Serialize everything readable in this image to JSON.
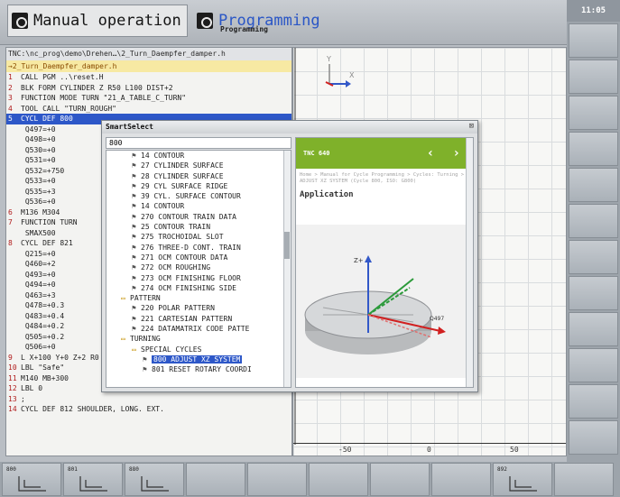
{
  "header": {
    "manual_label": "Manual operation",
    "programming_label": "Programming",
    "programming_sub": "Programming",
    "clock": "11:05"
  },
  "program": {
    "path": "TNC:\\nc_prog\\demo\\Drehen…\\2_Turn_Daempfer_damper.h",
    "file": "→2_Turn_Daempfer_damper.h",
    "lines": [
      {
        "n": "1",
        "text": "CALL PGM ..\\reset.H"
      },
      {
        "n": "2",
        "text": "BLK FORM CYLINDER Z R50 L100 DIST+2"
      },
      {
        "n": "3",
        "text": "FUNCTION MODE TURN \"21_A_TABLE_C_TURN\""
      },
      {
        "n": "4",
        "text": "TOOL CALL \"TURN_ROUGH\""
      },
      {
        "n": "5",
        "text": "CYCL DEF 800"
      },
      {
        "n": "",
        "text": "  Q497=+0"
      },
      {
        "n": "",
        "text": "  Q498=+0"
      },
      {
        "n": "",
        "text": "  Q530=+0"
      },
      {
        "n": "",
        "text": "  Q531=+0"
      },
      {
        "n": "",
        "text": "  Q532=+750"
      },
      {
        "n": "",
        "text": "  Q533=+0"
      },
      {
        "n": "",
        "text": "  Q535=+3"
      },
      {
        "n": "",
        "text": "  Q536=+0"
      },
      {
        "n": "6",
        "text": "M136 M304"
      },
      {
        "n": "7",
        "text": "FUNCTION TURN"
      },
      {
        "n": "",
        "text": "  SMAX500"
      },
      {
        "n": "8",
        "text": "CYCL DEF 821"
      },
      {
        "n": "",
        "text": "  Q215=+0"
      },
      {
        "n": "",
        "text": "  Q460=+2"
      },
      {
        "n": "",
        "text": "  Q493=+0"
      },
      {
        "n": "",
        "text": "  Q494=+0"
      },
      {
        "n": "",
        "text": "  Q463=+3"
      },
      {
        "n": "",
        "text": "  Q478=+0.3"
      },
      {
        "n": "",
        "text": "  Q483=+0.4"
      },
      {
        "n": "",
        "text": "  Q484=+0.2"
      },
      {
        "n": "",
        "text": "  Q505=+0.2"
      },
      {
        "n": "",
        "text": "  Q506=+0"
      },
      {
        "n": "9",
        "text": "L  X+100  Y+0  Z+2 R0 FMAX M99"
      },
      {
        "n": "10",
        "text": "LBL \"Safe\""
      },
      {
        "n": "11",
        "text": "M140 MB+300"
      },
      {
        "n": "12",
        "text": "LBL 0"
      },
      {
        "n": "13",
        "text": ";"
      },
      {
        "n": "14",
        "text": "CYCL DEF 812 SHOULDER, LONG. EXT."
      }
    ]
  },
  "graphic": {
    "ruler_left": "-50",
    "ruler_mid": "0",
    "ruler_right": "50"
  },
  "smartselect": {
    "title": "SmartSelect",
    "search_value": "800",
    "tree": [
      {
        "icon": "cycle",
        "indent": 2,
        "text": "14 CONTOUR"
      },
      {
        "icon": "cycle",
        "indent": 2,
        "text": "27 CYLINDER SURFACE"
      },
      {
        "icon": "cycle",
        "indent": 2,
        "text": "28 CYLINDER SURFACE"
      },
      {
        "icon": "cycle",
        "indent": 2,
        "text": "29 CYL SURFACE RIDGE"
      },
      {
        "icon": "cycle",
        "indent": 2,
        "text": "39 CYL. SURFACE CONTOUR"
      },
      {
        "icon": "cycle",
        "indent": 2,
        "text": "14 CONTOUR"
      },
      {
        "icon": "cycle",
        "indent": 2,
        "text": "270 CONTOUR TRAIN DATA"
      },
      {
        "icon": "cycle",
        "indent": 2,
        "text": "25 CONTOUR TRAIN"
      },
      {
        "icon": "cycle",
        "indent": 2,
        "text": "275 TROCHOIDAL SLOT"
      },
      {
        "icon": "cycle",
        "indent": 2,
        "text": "276 THREE-D CONT. TRAIN"
      },
      {
        "icon": "cycle",
        "indent": 2,
        "text": "271 OCM CONTOUR DATA"
      },
      {
        "icon": "cycle",
        "indent": 2,
        "text": "272 OCM ROUGHING"
      },
      {
        "icon": "cycle",
        "indent": 2,
        "text": "273 OCM FINISHING FLOOR"
      },
      {
        "icon": "cycle",
        "indent": 2,
        "text": "274 OCM FINISHING SIDE"
      },
      {
        "icon": "folder",
        "indent": 1,
        "text": "PATTERN"
      },
      {
        "icon": "cycle",
        "indent": 2,
        "text": "220 POLAR PATTERN"
      },
      {
        "icon": "cycle",
        "indent": 2,
        "text": "221 CARTESIAN PATTERN"
      },
      {
        "icon": "cycle",
        "indent": 2,
        "text": "224 DATAMATRIX CODE PATTE"
      },
      {
        "icon": "folder",
        "indent": 1,
        "text": "TURNING"
      },
      {
        "icon": "folder",
        "indent": 2,
        "text": "SPECIAL CYCLES"
      },
      {
        "icon": "cycle",
        "indent": 3,
        "text": "800 ADJUST XZ SYSTEM",
        "selected": true
      },
      {
        "icon": "cycle",
        "indent": 3,
        "text": "801 RESET ROTARY COORDI"
      }
    ],
    "help": {
      "product": "TNC 640",
      "nav_arrows": "‹ ›",
      "breadcrumb": "Home > Manual for Cycle Programming > Cycles: Turning > ADJUST XZ SYSTEM (Cycle 800, ISO: G800)",
      "heading": "Application",
      "fig_axis_z": "Z+",
      "fig_label": "Q497"
    }
  },
  "softkeys": [
    {
      "label": "800"
    },
    {
      "label": "801"
    },
    {
      "label": "880"
    },
    {
      "label": ""
    },
    {
      "label": ""
    },
    {
      "label": ""
    },
    {
      "label": ""
    },
    {
      "label": ""
    },
    {
      "label": "892"
    },
    {
      "label": ""
    }
  ]
}
